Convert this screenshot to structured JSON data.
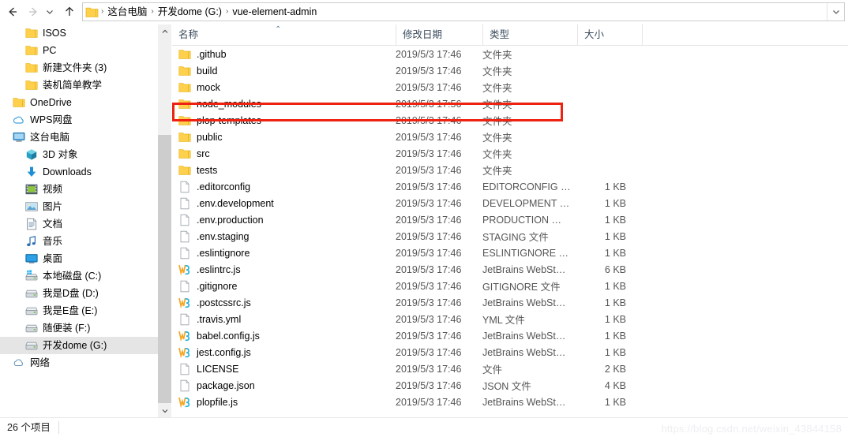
{
  "window": {
    "title": "vue-element-admin",
    "watermark": "https://blog.csdn.net/weixin_43844158"
  },
  "toolbar": {
    "back_label": "←",
    "forward_label": "→",
    "recent_label": "⌄",
    "up_label": "↑",
    "address_dropdown_label": "⌄"
  },
  "address": {
    "crumbs": [
      "这台电脑",
      "开发dome (G:)",
      "vue-element-admin"
    ],
    "separator": "›"
  },
  "sidebar": {
    "items": [
      {
        "label": "ISOS",
        "icon": "folder-icon",
        "indent": 32,
        "selected": false
      },
      {
        "label": "PC",
        "icon": "folder-icon",
        "indent": 32,
        "selected": false
      },
      {
        "label": "新建文件夹 (3)",
        "icon": "folder-icon",
        "indent": 32,
        "selected": false
      },
      {
        "label": "装机简单教学",
        "icon": "folder-icon",
        "indent": 32,
        "selected": false
      },
      {
        "label": "OneDrive",
        "icon": "folder-icon",
        "indent": 16,
        "selected": false
      },
      {
        "label": "WPS网盘",
        "icon": "cloud-icon",
        "indent": 16,
        "selected": false
      },
      {
        "label": "这台电脑",
        "icon": "monitor-icon",
        "indent": 16,
        "selected": false
      },
      {
        "label": "3D 对象",
        "icon": "cube-icon",
        "indent": 32,
        "selected": false
      },
      {
        "label": "Downloads",
        "icon": "download-icon",
        "indent": 32,
        "selected": false
      },
      {
        "label": "视频",
        "icon": "video-icon",
        "indent": 32,
        "selected": false
      },
      {
        "label": "图片",
        "icon": "picture-icon",
        "indent": 32,
        "selected": false
      },
      {
        "label": "文档",
        "icon": "document-icon",
        "indent": 32,
        "selected": false
      },
      {
        "label": "音乐",
        "icon": "music-icon",
        "indent": 32,
        "selected": false
      },
      {
        "label": "桌面",
        "icon": "desktop-icon",
        "indent": 32,
        "selected": false
      },
      {
        "label": "本地磁盘 (C:)",
        "icon": "windows-drive-icon",
        "indent": 32,
        "selected": false
      },
      {
        "label": "我是D盘 (D:)",
        "icon": "drive-icon",
        "indent": 32,
        "selected": false
      },
      {
        "label": "我是E盘 (E:)",
        "icon": "drive-icon",
        "indent": 32,
        "selected": false
      },
      {
        "label": "随便装 (F:)",
        "icon": "drive-icon",
        "indent": 32,
        "selected": false
      },
      {
        "label": "开发dome (G:)",
        "icon": "drive-icon",
        "indent": 32,
        "selected": true
      },
      {
        "label": "网络",
        "icon": "network-icon",
        "indent": 16,
        "selected": false
      }
    ]
  },
  "columns": {
    "name": "名称",
    "date": "修改日期",
    "type": "类型",
    "size": "大小",
    "sort_indicator": "⌃"
  },
  "files": [
    {
      "name": ".github",
      "date": "2019/5/3 17:46",
      "type": "文件夹",
      "size": "",
      "icon": "folder-icon"
    },
    {
      "name": "build",
      "date": "2019/5/3 17:46",
      "type": "文件夹",
      "size": "",
      "icon": "folder-icon"
    },
    {
      "name": "mock",
      "date": "2019/5/3 17:46",
      "type": "文件夹",
      "size": "",
      "icon": "folder-icon"
    },
    {
      "name": "node_modules",
      "date": "2019/5/3 17:56",
      "type": "文件夹",
      "size": "",
      "icon": "folder-icon"
    },
    {
      "name": "plop-templates",
      "date": "2019/5/3 17:46",
      "type": "文件夹",
      "size": "",
      "icon": "folder-icon"
    },
    {
      "name": "public",
      "date": "2019/5/3 17:46",
      "type": "文件夹",
      "size": "",
      "icon": "folder-icon"
    },
    {
      "name": "src",
      "date": "2019/5/3 17:46",
      "type": "文件夹",
      "size": "",
      "icon": "folder-icon"
    },
    {
      "name": "tests",
      "date": "2019/5/3 17:46",
      "type": "文件夹",
      "size": "",
      "icon": "folder-icon"
    },
    {
      "name": ".editorconfig",
      "date": "2019/5/3 17:46",
      "type": "EDITORCONFIG …",
      "size": "1 KB",
      "icon": "file-icon"
    },
    {
      "name": ".env.development",
      "date": "2019/5/3 17:46",
      "type": "DEVELOPMENT …",
      "size": "1 KB",
      "icon": "file-icon"
    },
    {
      "name": ".env.production",
      "date": "2019/5/3 17:46",
      "type": "PRODUCTION …",
      "size": "1 KB",
      "icon": "file-icon"
    },
    {
      "name": ".env.staging",
      "date": "2019/5/3 17:46",
      "type": "STAGING 文件",
      "size": "1 KB",
      "icon": "file-icon"
    },
    {
      "name": ".eslintignore",
      "date": "2019/5/3 17:46",
      "type": "ESLINTIGNORE …",
      "size": "1 KB",
      "icon": "file-icon"
    },
    {
      "name": ".eslintrc.js",
      "date": "2019/5/3 17:46",
      "type": "JetBrains WebSt…",
      "size": "6 KB",
      "icon": "webstorm-icon"
    },
    {
      "name": ".gitignore",
      "date": "2019/5/3 17:46",
      "type": "GITIGNORE 文件",
      "size": "1 KB",
      "icon": "file-icon"
    },
    {
      "name": ".postcssrc.js",
      "date": "2019/5/3 17:46",
      "type": "JetBrains WebSt…",
      "size": "1 KB",
      "icon": "webstorm-icon"
    },
    {
      "name": ".travis.yml",
      "date": "2019/5/3 17:46",
      "type": "YML 文件",
      "size": "1 KB",
      "icon": "file-icon"
    },
    {
      "name": "babel.config.js",
      "date": "2019/5/3 17:46",
      "type": "JetBrains WebSt…",
      "size": "1 KB",
      "icon": "webstorm-icon"
    },
    {
      "name": "jest.config.js",
      "date": "2019/5/3 17:46",
      "type": "JetBrains WebSt…",
      "size": "1 KB",
      "icon": "webstorm-icon"
    },
    {
      "name": "LICENSE",
      "date": "2019/5/3 17:46",
      "type": "文件",
      "size": "2 KB",
      "icon": "file-icon"
    },
    {
      "name": "package.json",
      "date": "2019/5/3 17:46",
      "type": "JSON 文件",
      "size": "4 KB",
      "icon": "file-icon"
    },
    {
      "name": "plopfile.js",
      "date": "2019/5/3 17:46",
      "type": "JetBrains WebSt…",
      "size": "1 KB",
      "icon": "webstorm-icon"
    }
  ],
  "annotation": {
    "target_row": "node_modules",
    "color": "#ee2211"
  },
  "statusbar": {
    "item_count": "26 个项目"
  },
  "colors": {
    "folder": "#ffd04b",
    "selection": "#e5e5e5",
    "header_text": "#3a4b5c",
    "secondary_text": "#555555",
    "annotation": "#ee2211"
  }
}
